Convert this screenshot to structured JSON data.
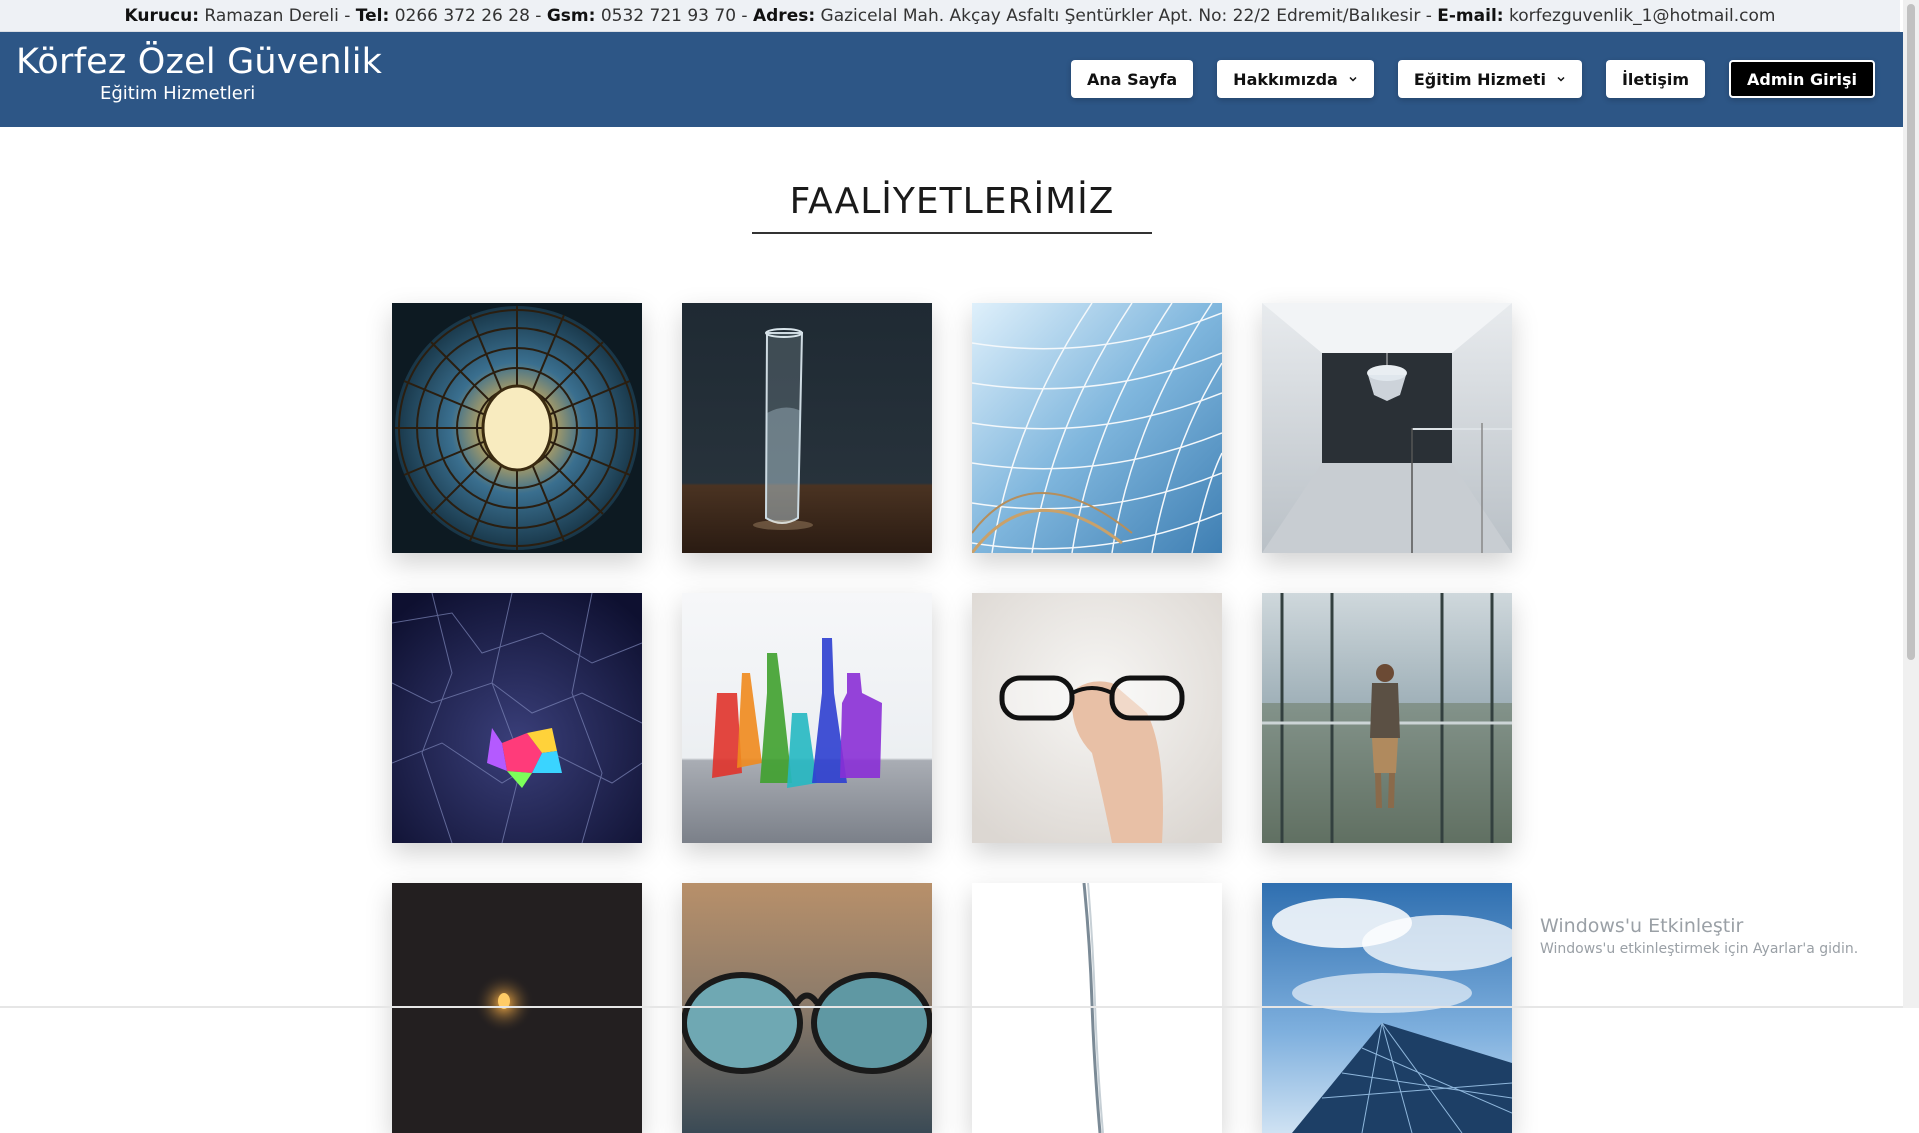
{
  "topbar": {
    "founder_label": "Kurucu:",
    "founder": "Ramazan Dereli",
    "sep": " - ",
    "tel_label": "Tel:",
    "tel": "0266 372 26 28",
    "gsm_label": "Gsm:",
    "gsm": "0532 721 93 70",
    "address_label": "Adres:",
    "address": "Gazicelal Mah. Akçay Asfaltı Şentürkler Apt. No: 22/2 Edremit/Balıkesir",
    "email_label": "E-mail:",
    "email": "korfezguvenlik_1@hotmail.com"
  },
  "brand": {
    "title": "Körfez Özel Güvenlik",
    "subtitle": "Eğitim Hizmetleri"
  },
  "nav": {
    "home": "Ana Sayfa",
    "about": "Hakkımızda",
    "training": "Eğitim Hizmeti",
    "contact": "İletişim",
    "admin": "Admin Girişi"
  },
  "section": {
    "title": "FAALİYETLERİMİZ"
  },
  "gallery": [
    {
      "icon": "stained-glass-dome-image"
    },
    {
      "icon": "water-glass-image"
    },
    {
      "icon": "glass-roof-image"
    },
    {
      "icon": "chandelier-room-image"
    },
    {
      "icon": "mosaic-glass-image"
    },
    {
      "icon": "colored-bottles-image"
    },
    {
      "icon": "eyeglasses-hand-image"
    },
    {
      "icon": "skyscraper-view-image"
    },
    {
      "icon": "dark-lamp-image"
    },
    {
      "icon": "sunglasses-image"
    },
    {
      "icon": "water-stream-image"
    },
    {
      "icon": "glass-building-sky-image"
    }
  ],
  "watermark": {
    "line1": "Windows'u Etkinleştir",
    "line2": "Windows'u etkinleştirmek için Ayarlar'a gidin."
  },
  "colors": {
    "header": "#2d5686",
    "topbar": "#eef1f5"
  }
}
